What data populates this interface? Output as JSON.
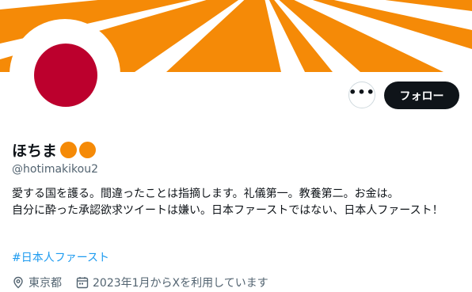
{
  "profile": {
    "display_name": "ほちま",
    "name_emoji_icons": [
      "orange-circle-icon",
      "orange-circle-icon"
    ],
    "handle": "@hotimakikou2",
    "bio_line1": "愛する国を護る。間違ったことは指摘します。礼儀第一。教養第二。お金は。",
    "bio_line2": "自分に酔った承認欲求ツイートは嫌い。日本ファーストではない、日本人ファースト！",
    "hashtag": "#日本人ファースト",
    "location": "東京都",
    "joined": "2023年1月からXを利用しています"
  },
  "actions": {
    "more_label": "•••",
    "follow_label": "フォロー"
  },
  "colors": {
    "banner_orange": "#f58a07",
    "avatar_red": "#bc002d",
    "link_blue": "#1d9bf0",
    "follow_bg": "#0f1419"
  }
}
